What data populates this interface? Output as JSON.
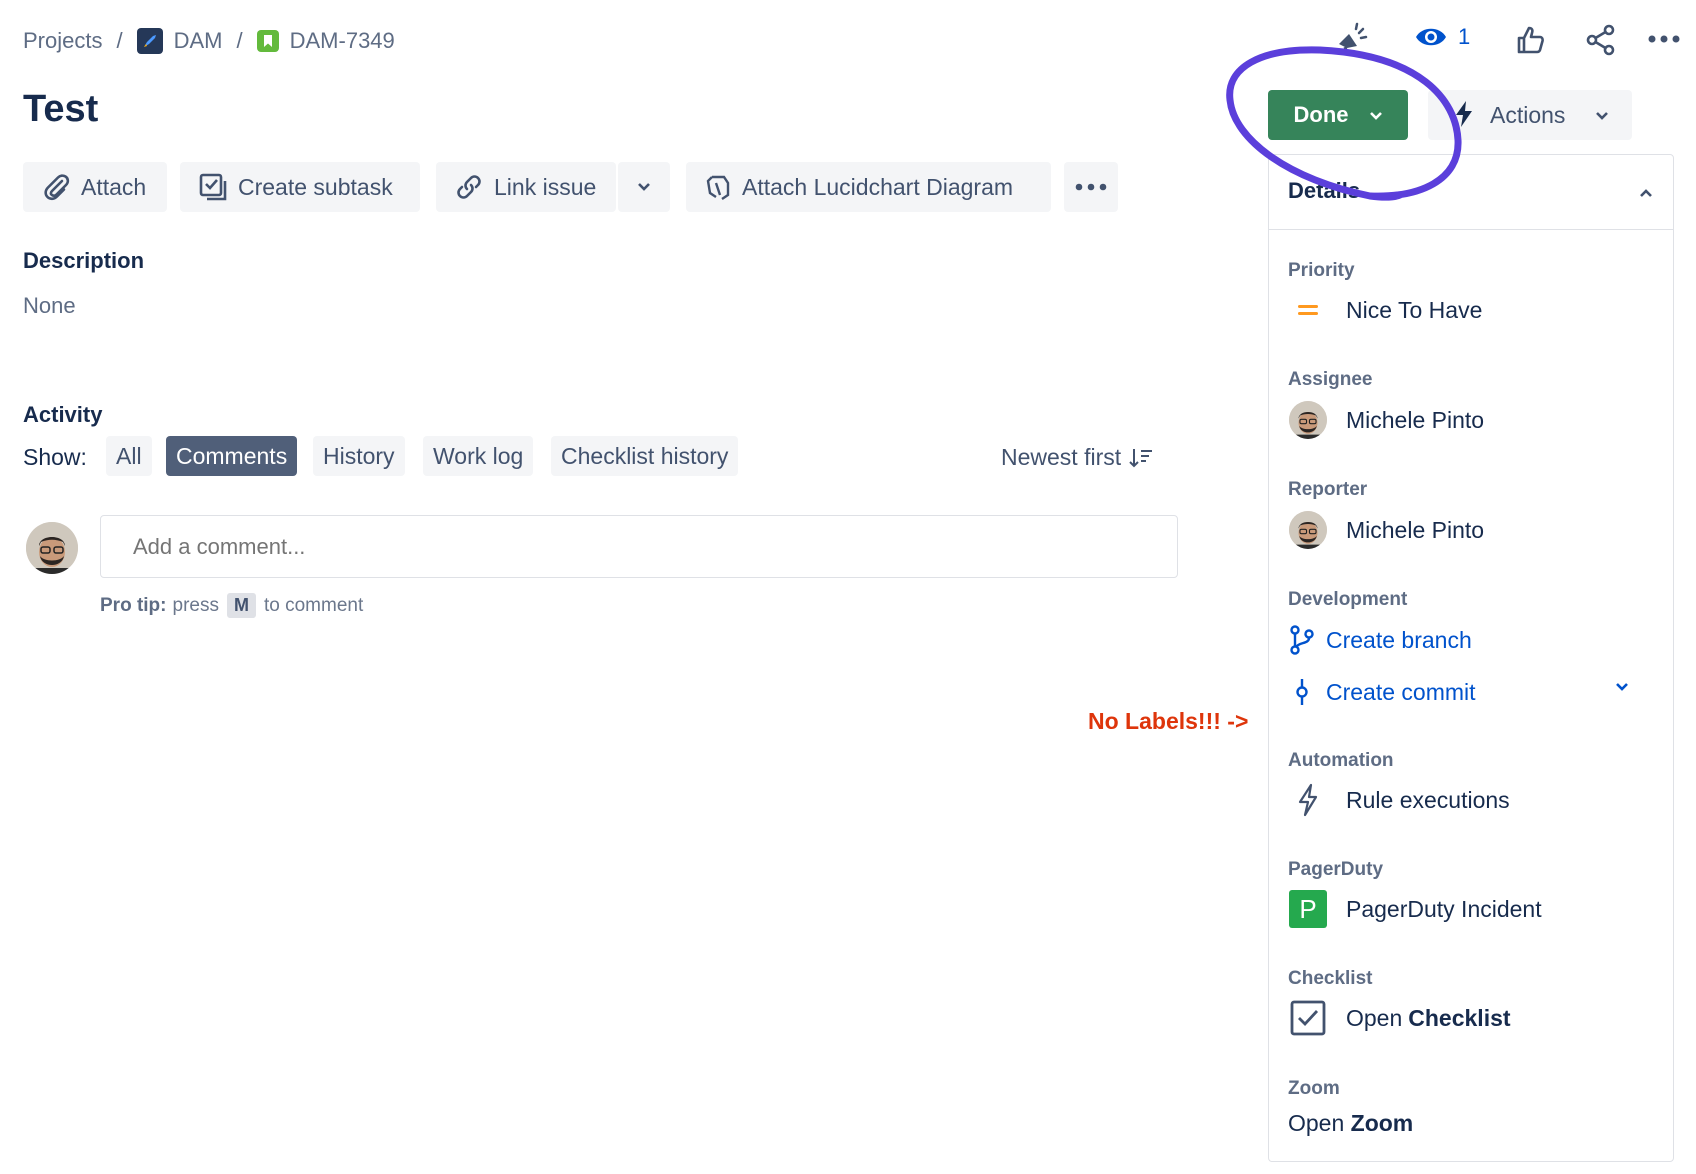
{
  "breadcrumb": {
    "projects": "Projects",
    "separator": "/",
    "project": "DAM",
    "issue_key": "DAM-7349"
  },
  "header": {
    "title": "Test",
    "watchers_count": "1"
  },
  "toolbar": {
    "attach": "Attach",
    "create_subtask": "Create subtask",
    "link_issue": "Link issue",
    "lucidchart": "Attach Lucidchart Diagram"
  },
  "description": {
    "heading": "Description",
    "value": "None"
  },
  "activity": {
    "heading": "Activity",
    "show_label": "Show:",
    "filters": [
      "All",
      "Comments",
      "History",
      "Work log",
      "Checklist history"
    ],
    "active_filter": "Comments",
    "sort": "Newest first",
    "comment_placeholder": "Add a comment...",
    "protip_bold": "Pro tip:",
    "protip_text1": "press",
    "protip_key": "M",
    "protip_text2": "to comment"
  },
  "annotation": {
    "text": "No Labels!!! ->",
    "color": "#de350b",
    "circle_color": "#5b3fdb"
  },
  "status": {
    "done_label": "Done",
    "done_color": "#36845a",
    "actions_label": "Actions"
  },
  "details": {
    "heading": "Details",
    "priority_label": "Priority",
    "priority_value": "Nice To Have",
    "assignee_label": "Assignee",
    "assignee_value": "Michele Pinto",
    "reporter_label": "Reporter",
    "reporter_value": "Michele Pinto",
    "development_label": "Development",
    "create_branch": "Create branch",
    "create_commit": "Create commit",
    "automation_label": "Automation",
    "rule_executions": "Rule executions",
    "pagerduty_label": "PagerDuty",
    "pagerduty_value": "PagerDuty Incident",
    "pagerduty_icon_letter": "P",
    "checklist_label": "Checklist",
    "checklist_open": "Open",
    "checklist_bold": "Checklist",
    "zoom_label": "Zoom",
    "zoom_open": "Open",
    "zoom_bold": "Zoom"
  },
  "icons": {
    "project": "rocket-icon",
    "issue_type": "story-bookmark-icon",
    "feedback": "megaphone-icon",
    "watch": "eye-icon",
    "like": "thumbs-up-icon",
    "share": "share-icon",
    "more": "more-horizontal-icon"
  }
}
